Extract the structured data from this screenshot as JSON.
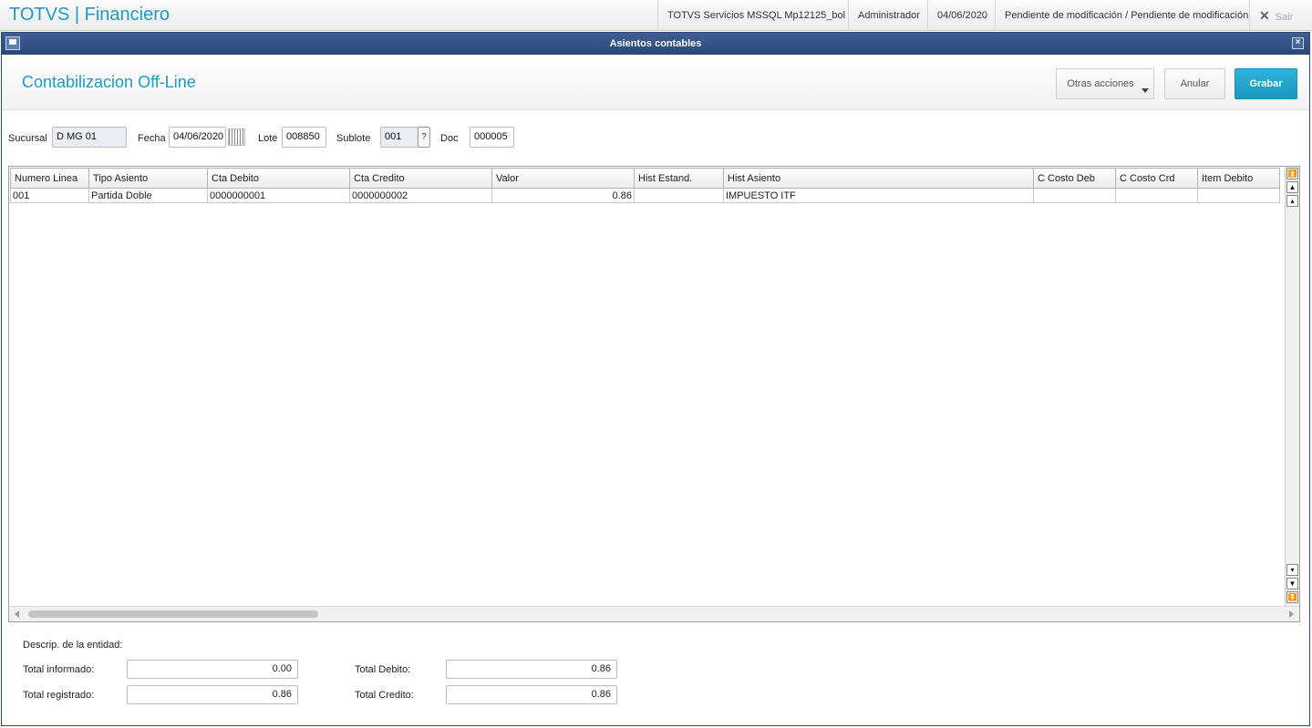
{
  "topbar": {
    "app_title": "TOTVS | Financiero",
    "environment": "TOTVS Servicios MSSQL Mp12125_bol",
    "user": "Administrador",
    "date": "04/06/2020",
    "status": "Pendiente de modificación / Pendiente de modificación",
    "exit_label": "Sair"
  },
  "window": {
    "title": "Asientos contables"
  },
  "header": {
    "page_title": "Contabilizacion Off-Line",
    "more_actions_label": "Otras acciones",
    "cancel_label": "Anular",
    "save_label": "Grabar"
  },
  "fields": {
    "sucursal_label": "Sucursal",
    "sucursal_value": "D MG 01",
    "fecha_label": "Fecha",
    "fecha_value": "04/06/2020",
    "lote_label": "Lote",
    "lote_value": "008850",
    "sublote_label": "Sublote",
    "sublote_value": "001",
    "help_label": "?",
    "doc_label": "Doc",
    "doc_value": "000005"
  },
  "grid": {
    "columns": [
      "Numero Linea",
      "Tipo Asiento",
      "Cta Debito",
      "Cta Credito",
      "Valor",
      "Hist Estand.",
      "Hist Asiento",
      "C Costo Deb",
      "C Costo Crd",
      "Item Debito"
    ],
    "rows": [
      [
        "001",
        "Partida Doble",
        "0000000001",
        "0000000002",
        "0.86",
        "",
        "IMPUESTO ITF",
        "",
        "",
        ""
      ]
    ]
  },
  "footer": {
    "entity_label": "Descrip. de la entidad:",
    "total_informado_label": "Total informado:",
    "total_informado": "0.00",
    "total_registrado_label": "Total registrado:",
    "total_registrado": "0.86",
    "total_debito_label": "Total Debito:",
    "total_debito": "0.86",
    "total_credito_label": "Total Credito:",
    "total_credito": "0.86"
  }
}
